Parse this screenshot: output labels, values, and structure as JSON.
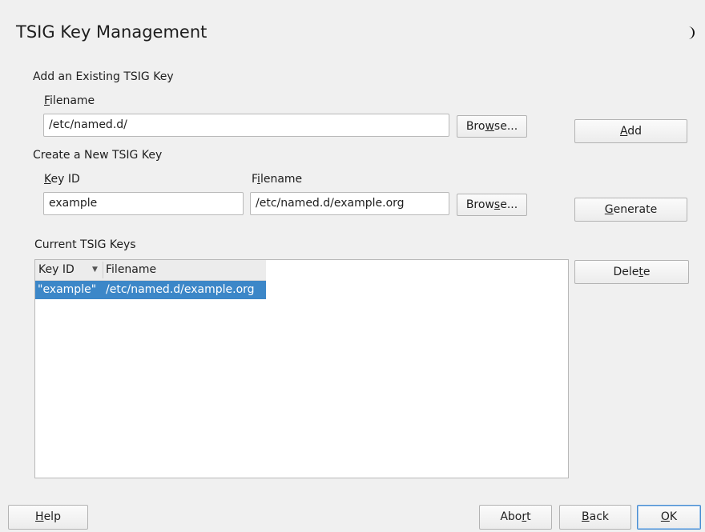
{
  "window": {
    "title": "TSIG Key Management"
  },
  "add_existing": {
    "section_label": "Add an Existing TSIG Key",
    "filename_label_pre": "",
    "filename_label_ul": "F",
    "filename_label_post": "ilename",
    "filename_value": "/etc/named.d/",
    "browse_pre": "Bro",
    "browse_ul": "w",
    "browse_post": "se...",
    "add_pre": "",
    "add_ul": "A",
    "add_post": "dd"
  },
  "create_new": {
    "section_label": "Create a New TSIG Key",
    "keyid_label_pre": "",
    "keyid_label_ul": "K",
    "keyid_label_post": "ey ID",
    "keyid_value": "example",
    "filename_label_pre": "F",
    "filename_label_ul": "i",
    "filename_label_post": "lename",
    "filename_value": "/etc/named.d/example.org",
    "browse_pre": "Brow",
    "browse_ul": "s",
    "browse_post": "e...",
    "generate_pre": "",
    "generate_ul": "G",
    "generate_post": "enerate"
  },
  "current_keys": {
    "section_label": "Current TSIG Keys",
    "columns": [
      "Key ID",
      "Filename"
    ],
    "sort_indicator": "▼",
    "rows": [
      {
        "key_id": "\"example\"",
        "filename": "/etc/named.d/example.org",
        "selected": true
      }
    ],
    "delete_pre": "Dele",
    "delete_ul": "t",
    "delete_post": "e"
  },
  "footer": {
    "help_pre": "",
    "help_ul": "H",
    "help_post": "elp",
    "abort_pre": "Abo",
    "abort_ul": "r",
    "abort_post": "t",
    "back_pre": "",
    "back_ul": "B",
    "back_post": "ack",
    "ok_pre": "",
    "ok_ul": "O",
    "ok_post": "K"
  },
  "icons": {
    "theme_toggle": "half-moon-icon"
  },
  "colors": {
    "selection": "#3c87c8",
    "background": "#f0f0f0",
    "default_button_border": "#4a8ed3"
  }
}
